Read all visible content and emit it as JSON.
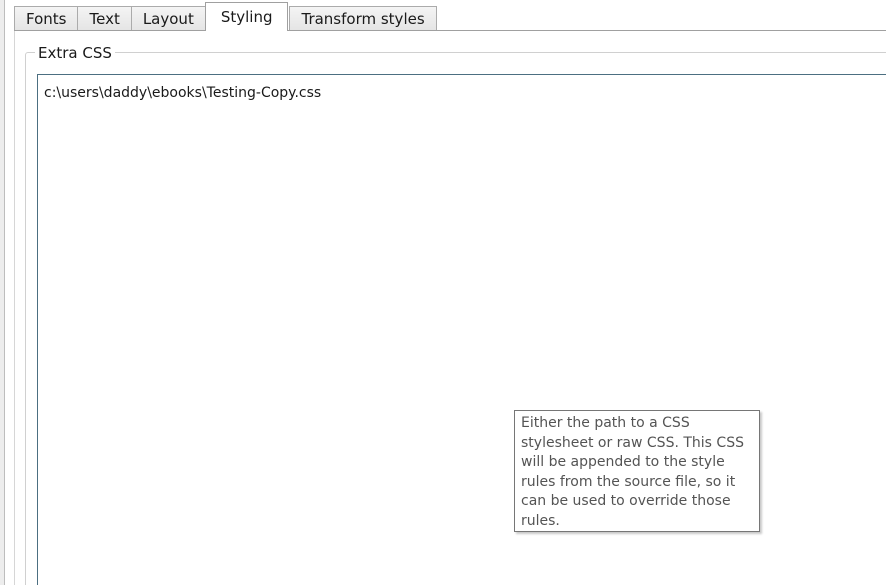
{
  "tabs": [
    {
      "label": "Fonts",
      "active": false
    },
    {
      "label": "Text",
      "active": false
    },
    {
      "label": "Layout",
      "active": false
    },
    {
      "label": "Styling",
      "active": true
    },
    {
      "label": "Transform styles",
      "active": false
    }
  ],
  "extra_css": {
    "group_title": "Extra CSS",
    "value": "c:\\users\\daddy\\ebooks\\Testing-Copy.css"
  },
  "tooltip": {
    "lines": [
      "Either the path to a CSS",
      "stylesheet or raw CSS. This CSS",
      "will be appended to the style",
      "rules from the source file, so it",
      "can be used to override those",
      "rules."
    ]
  }
}
